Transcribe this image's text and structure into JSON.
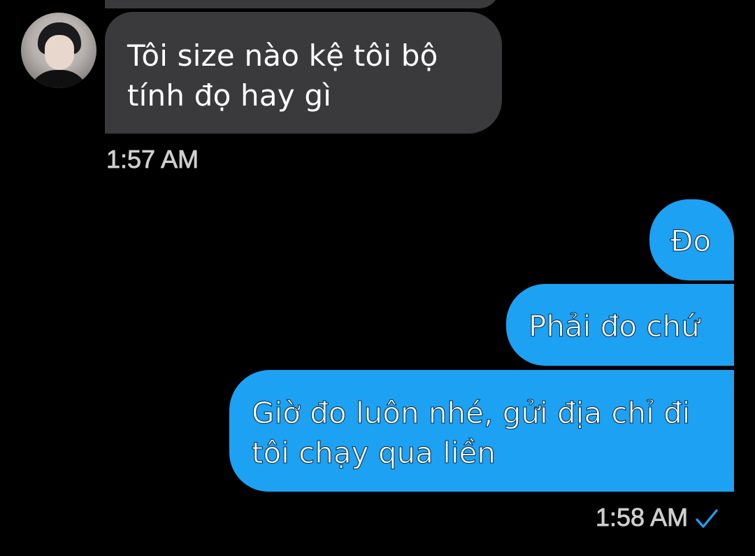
{
  "colors": {
    "background": "#000000",
    "received_bubble": "#3a3a3c",
    "sent_bubble": "#1da1f2",
    "timestamp": "#cfcfcf",
    "read_check": "#1da1f2"
  },
  "received": {
    "avatar_icon": "avatar-person-photo",
    "message": "Tôi size nào kệ tôi bộ\ntính đọ hay gì",
    "timestamp": "1:57 AM"
  },
  "sent": {
    "messages": [
      "Đo",
      "Phải đo chứ",
      "Giờ đo luôn nhé, gửi địa chỉ đi\ntôi chạy qua liền"
    ],
    "timestamp": "1:58 AM",
    "status_icon": "checkmark-icon"
  }
}
